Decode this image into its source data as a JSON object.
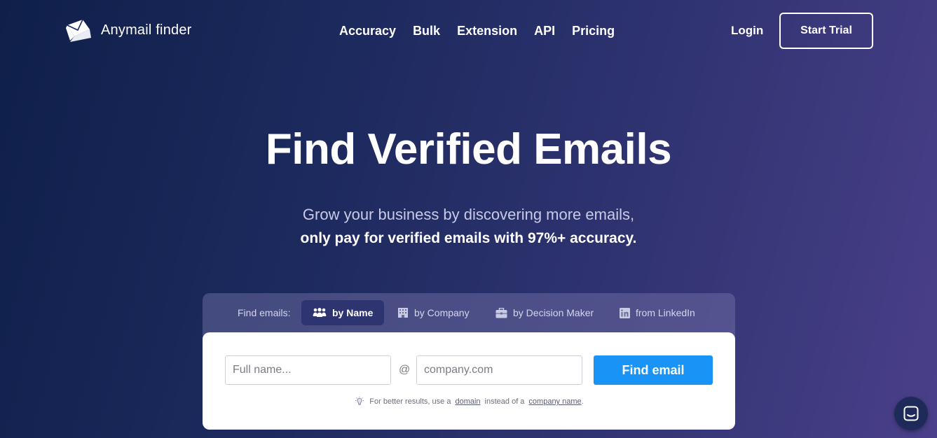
{
  "brand": {
    "name": "Anymail finder"
  },
  "nav": {
    "items": [
      {
        "label": "Accuracy"
      },
      {
        "label": "Bulk"
      },
      {
        "label": "Extension"
      },
      {
        "label": "API"
      },
      {
        "label": "Pricing"
      }
    ],
    "login_label": "Login",
    "start_trial_label": "Start Trial"
  },
  "hero": {
    "title": "Find Verified Emails",
    "subtitle_line1": "Grow your business by discovering more emails,",
    "subtitle_line2": "only pay for verified emails with 97%+ accuracy."
  },
  "search": {
    "tabs_label": "Find emails:",
    "tabs": [
      {
        "label": "by Name",
        "icon": "people-icon",
        "active": true
      },
      {
        "label": "by Company",
        "icon": "building-icon",
        "active": false
      },
      {
        "label": "by Decision Maker",
        "icon": "briefcase-icon",
        "active": false
      },
      {
        "label": "from LinkedIn",
        "icon": "linkedin-icon",
        "active": false
      }
    ],
    "name_placeholder": "Full name...",
    "at_symbol": "@",
    "domain_placeholder": "company.com",
    "button_label": "Find email",
    "hint": {
      "prefix": "For better results, use a",
      "link1": "domain",
      "middle": "instead of a",
      "link2": "company name",
      "suffix": "."
    }
  },
  "colors": {
    "accent": "#1a93f6",
    "active_tab": "#2e3470"
  }
}
